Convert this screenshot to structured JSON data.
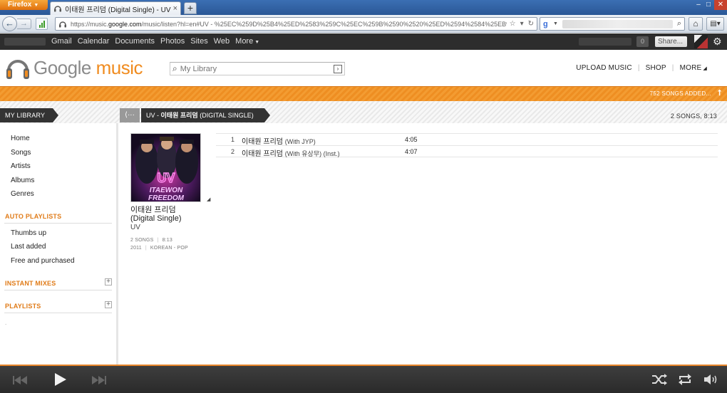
{
  "browser": {
    "firefox_label": "Firefox",
    "tab_title": "이태원 프리덤 (Digital Single) - UV - Google ...",
    "new_tab": "+",
    "url_host": "https://music.",
    "url_domain": "google.com",
    "url_rest": "/music/listen?hl=en#UV - %25EC%259D%25B4%25ED%2583%259C%25EC%259B%2590%2520%25ED%2594%2584%25EB%25A6%25AC%25ED%2594%2584"
  },
  "gbar": {
    "links": [
      "Gmail",
      "Calendar",
      "Documents",
      "Photos",
      "Sites",
      "Web",
      "More"
    ],
    "notif_count": "0",
    "share": "Share..."
  },
  "header": {
    "logo_google": "Google",
    "logo_music": "music",
    "search_placeholder": "My Library",
    "upload": "UPLOAD MUSIC",
    "shop": "SHOP",
    "more": "MORE"
  },
  "status": {
    "songs_added": "752 SONGS ADDED..."
  },
  "library": {
    "label": "MY LIBRARY",
    "breadcrumb_artist": "UV",
    "breadcrumb_sep": " - ",
    "breadcrumb_album": "이태원 프리덤",
    "breadcrumb_suffix": "(DIGITAL SINGLE)",
    "summary": "2 SONGS, 8:13"
  },
  "sidebar": {
    "nav": [
      "Home",
      "Songs",
      "Artists",
      "Albums",
      "Genres"
    ],
    "auto_playlists_title": "AUTO PLAYLISTS",
    "auto_playlists": [
      "Thumbs up",
      "Last added",
      "Free and purchased"
    ],
    "instant_mixes_title": "INSTANT MIXES",
    "playlists_title": "PLAYLISTS",
    "plus": "+"
  },
  "album": {
    "art_text_top": "UV",
    "art_text_line1": "ITAEWON",
    "art_text_line2": "FREEDOM",
    "title_line1": "이태원 프리덤",
    "title_line2": "(Digital Single)",
    "artist": "UV",
    "songs": "2 SONGS",
    "duration": "8:13",
    "year": "2011",
    "genre": "KOREAN - POP"
  },
  "tracks": [
    {
      "num": "1",
      "title": "이태원 프리덤",
      "sub": "(With JYP)",
      "duration": "4:05"
    },
    {
      "num": "2",
      "title": "이태원 프리덤",
      "sub": "(With 유상무) (Inst.)",
      "duration": "4:07"
    }
  ],
  "colors": {
    "accent": "#f08c20",
    "dark": "#333333"
  }
}
